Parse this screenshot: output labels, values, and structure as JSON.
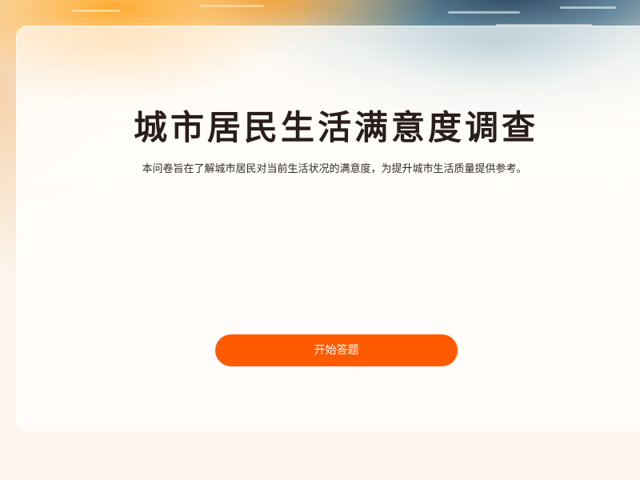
{
  "survey": {
    "title": "城市居民生活满意度调查",
    "description": "本问卷旨在了解城市居民对当前生活状况的满意度，为提升城市生活质量提供参考。",
    "start_button_label": "开始答题"
  },
  "colors": {
    "accent": "#ff5a00",
    "title_text": "#2a1e1c",
    "card_background": "#fffcf9",
    "page_background": "#fdf5ec"
  }
}
